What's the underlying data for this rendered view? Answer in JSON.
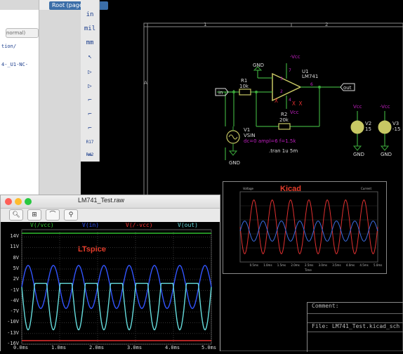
{
  "window": {
    "title": "Root (page 1)"
  },
  "hierarchy": {
    "search_placeholder": "normal)",
    "lines": [
      "tion/",
      "4-_U1-NC-"
    ]
  },
  "toolbar": {
    "items": [
      {
        "label": "in"
      },
      {
        "label": "mil"
      },
      {
        "label": "mm"
      },
      {
        "label": "↖"
      },
      {
        "label": "▷"
      },
      {
        "label": "▷"
      },
      {
        "label": "⌐"
      },
      {
        "label": "⌐"
      },
      {
        "label": "⌐"
      },
      {
        "label": "R17 R42"
      },
      {
        "label": "▭"
      }
    ]
  },
  "schematic": {
    "frame_cols": [
      "1",
      "2"
    ],
    "frame_rows": [
      "A"
    ],
    "nets": {
      "neg_vcc_top": "-Vcc",
      "gnd_top": "GND",
      "in_label": "in",
      "out_label": "out",
      "vcc_bottom": "Vcc"
    },
    "u1": {
      "ref": "U1",
      "value": "LM741",
      "pins": [
        "3",
        "2",
        "6",
        "7",
        "4"
      ]
    },
    "r1": {
      "ref": "R1",
      "value": "10k"
    },
    "r2": {
      "ref": "R2",
      "value": "20k"
    },
    "v1": {
      "ref": "V1",
      "type": "VSIN",
      "params": "dc=0 ampl=6 f=1.5k",
      "gnd": "GND"
    },
    "v2": {
      "ref": "V2",
      "value": "15",
      "net": "Vcc",
      "gnd": "GND"
    },
    "v3": {
      "ref": "V3",
      "value": "-15",
      "net": "-Vcc",
      "gnd": "GND"
    },
    "directive": ".tran 1u 5m",
    "inset_label": "Kicad",
    "inset_header_left": "Voltage",
    "inset_header_right": "Current",
    "inset_xlabel": "Time",
    "inset_ticks": [
      "0.5ms",
      "1.0ms",
      "1.5ms",
      "2.0ms",
      "2.5ms",
      "3.0ms",
      "3.5ms",
      "4.0ms",
      "4.5ms",
      "5.0ms"
    ]
  },
  "title_block": {
    "comment": "Comment:",
    "file": "File: LM741_Test.kicad_sch"
  },
  "ltspice": {
    "title": "LM741_Test.raw",
    "legend": [
      {
        "name": "V(/vcc)",
        "color": "#33cc33"
      },
      {
        "name": "V(in)",
        "color": "#3355ff"
      },
      {
        "name": "V(/-vcc)",
        "color": "#ff3333"
      },
      {
        "name": "V(out)",
        "color": "#66dddd"
      }
    ],
    "watermark": "LTspice",
    "yticks": [
      "14V",
      "11V",
      "8V",
      "5V",
      "2V",
      "-1V",
      "-4V",
      "-7V",
      "-10V",
      "-13V",
      "-16V"
    ],
    "xticks": [
      "0.0ms",
      "1.0ms",
      "2.0ms",
      "3.0ms",
      "4.0ms",
      "5.0ms"
    ]
  },
  "chart_data": {
    "type": "line",
    "xlabel": "",
    "ylabel": "",
    "xlim": [
      0,
      5
    ],
    "ylim": [
      -16,
      16
    ],
    "series": [
      {
        "name": "V(/vcc)",
        "color": "#33cc33",
        "kind": "const",
        "value": 15
      },
      {
        "name": "V(in)",
        "color": "#3355ff",
        "kind": "sine",
        "amplitude": 6,
        "offset": 0,
        "freq_per_ms": 1.5
      },
      {
        "name": "V(/-vcc)",
        "color": "#ff3333",
        "kind": "const",
        "value": -15
      },
      {
        "name": "V(out)",
        "color": "#66dddd",
        "kind": "sine_clip",
        "amplitude": 12,
        "offset": 0,
        "freq_per_ms": 1.5,
        "clip_high": 1,
        "invert": true
      }
    ]
  },
  "colors": {
    "kicad_bg": "#000000",
    "wire": "#3ca83c",
    "component": "#a0a040",
    "net_label": "#c020c0"
  }
}
